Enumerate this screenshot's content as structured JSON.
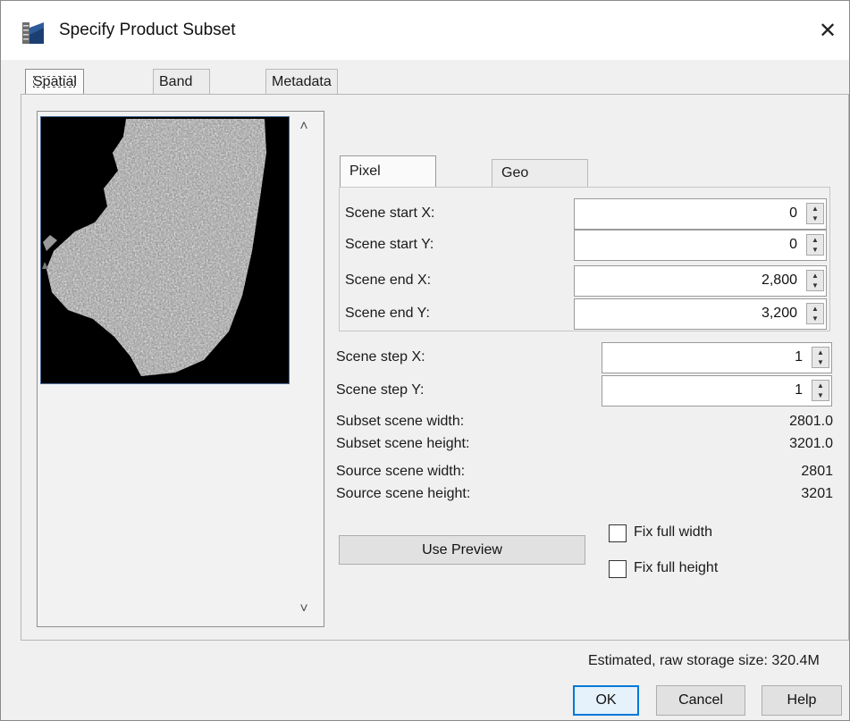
{
  "window": {
    "title": "Specify Product Subset",
    "close_glyph": "✕",
    "app_icon": "snap-app-icon"
  },
  "tabs": [
    {
      "label": "Spatial Subset",
      "active": true
    },
    {
      "label": "Band Subset",
      "active": false
    },
    {
      "label": "Metadata Subset",
      "active": false
    }
  ],
  "preview": {
    "scroll_up": "˄",
    "scroll_down": "˅"
  },
  "coord_tabs": [
    {
      "label": "Pixel Coordinates",
      "active": true
    },
    {
      "label": "Geo Coordinates",
      "active": false
    }
  ],
  "pixel_fields": [
    {
      "label": "Scene start X:",
      "value": "0"
    },
    {
      "label": "Scene start Y:",
      "value": "0"
    },
    {
      "label": "Scene end X:",
      "value": "2,800"
    },
    {
      "label": "Scene end Y:",
      "value": "3,200"
    }
  ],
  "step_fields": [
    {
      "label": "Scene step X:",
      "value": "1"
    },
    {
      "label": "Scene step Y:",
      "value": "1"
    }
  ],
  "info": [
    {
      "label": "Subset scene width:",
      "value": "2801.0"
    },
    {
      "label": "Subset scene height:",
      "value": "3201.0"
    },
    {
      "label": "Source scene width:",
      "value": "2801"
    },
    {
      "label": "Source scene height:",
      "value": "3201"
    }
  ],
  "use_preview": "Use Preview",
  "fix_full_width": {
    "label": "Fix full width",
    "checked": false
  },
  "fix_full_height": {
    "label": "Fix full height",
    "checked": false
  },
  "storage": "Estimated, raw storage size: 320.4M",
  "buttons": {
    "ok": "OK",
    "cancel": "Cancel",
    "help": "Help"
  },
  "colors": {
    "accent": "#0078d7",
    "panel": "#f0f0f0"
  }
}
